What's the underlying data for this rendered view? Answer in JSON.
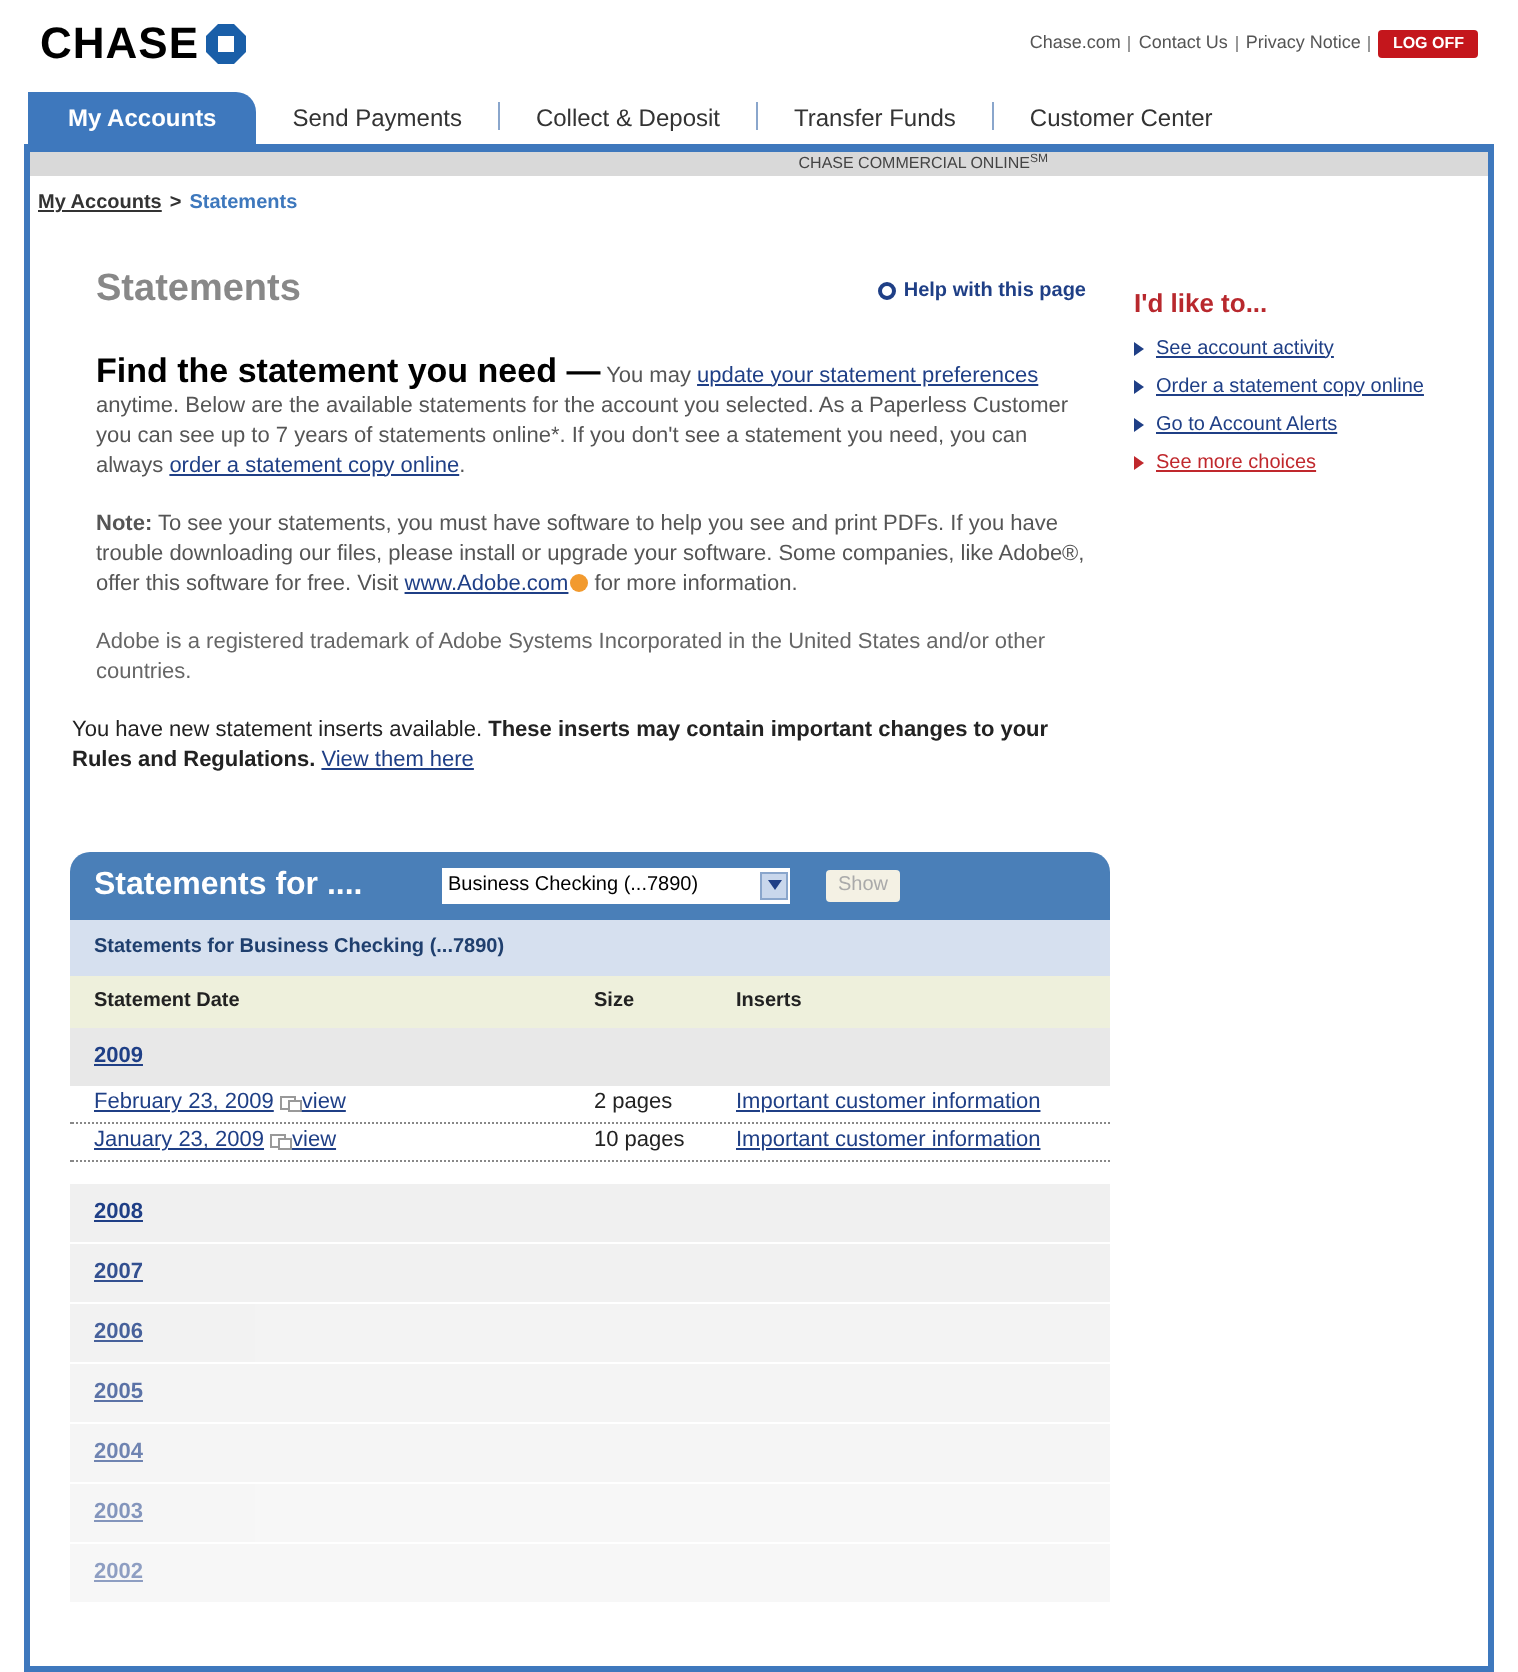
{
  "header": {
    "logo": "CHASE",
    "links": [
      "Chase.com",
      "Contact Us",
      "Privacy Notice"
    ],
    "logoff": "LOG OFF"
  },
  "tabs": [
    {
      "label": "My Accounts",
      "selected": true
    },
    {
      "label": "Send Payments",
      "selected": false
    },
    {
      "label": "Collect & Deposit",
      "selected": false
    },
    {
      "label": "Transfer Funds",
      "selected": false
    },
    {
      "label": "Customer Center",
      "selected": false
    }
  ],
  "banner": "CHASE COMMERCIAL ONLINE$^{SM}$",
  "breadcrumb": [
    {
      "label": "My Accounts",
      "kind": "link"
    },
    {
      "label": ">",
      "kind": "sep"
    },
    {
      "label": "Statements",
      "kind": "current"
    }
  ],
  "page_title": "Statements",
  "help_link": "Help with this page",
  "intro": {
    "heading": "Find the statement you need —",
    "parts": [
      {
        "kind": "text",
        "text": "You may"
      },
      {
        "kind": "link",
        "text": "update your statement preferences"
      },
      {
        "kind": "text",
        "text": "anytime. Below are the available statements for the account you selected. As a Paperless Customer you can see up to 7 years of statements online*. If you don't see a statement you need, you can always"
      },
      {
        "kind": "link",
        "text": "order a statement copy online"
      },
      {
        "kind": "text",
        "text": "."
      }
    ]
  },
  "note": [
    {
      "kind": "text",
      "text": "**Note:** To see your statements, you must have software to help you see and print PDFs. If you have trouble downloading our files, please install or upgrade your software. Some companies, like Adobe®, offer this software for free. Visit"
    },
    {
      "kind": "link",
      "text": "www.Adobe.com"
    },
    {
      "kind": "text",
      "text": "for more information."
    }
  ],
  "trademark": "Adobe is a registered trademark of Adobe Systems Incorporated in the United States and/or other countries.",
  "inserts_notice": {
    "text": "You have new statement inserts available. **These inserts may contain important changes to your Rules and Regulations.**",
    "link": "View them here"
  },
  "statements_panel": {
    "title": "Statements for ....",
    "account_select": {
      "value": "Business Checking (...7890)"
    },
    "show_button": {
      "label": "Show",
      "disabled": true
    },
    "subtitle": "Statements for Business Checking (...7890)",
    "columns": [
      "Statement Date",
      "Size",
      "Inserts"
    ],
    "years": [
      {
        "year": "2009",
        "statements": [
          {
            "date": "February 23, 2009",
            "view": "view",
            "size": "2 pages",
            "inserts": "Important customer information"
          },
          {
            "date": "January 23, 2009",
            "view": "view",
            "size": "10 pages",
            "inserts": "Important customer information"
          }
        ]
      },
      {
        "year": "2008"
      },
      {
        "year": "2007"
      },
      {
        "year": "2006"
      },
      {
        "year": "2005"
      },
      {
        "year": "2004"
      },
      {
        "year": "2003"
      },
      {
        "year": "2002"
      }
    ]
  },
  "sidebar": {
    "title": "I'd like to...",
    "links": [
      {
        "label": "See account activity",
        "kind": "normal"
      },
      {
        "label": "Order a statement copy online",
        "kind": "normal"
      },
      {
        "label": "Go to Account Alerts",
        "kind": "normal"
      },
      {
        "label": "See more choices",
        "kind": "more"
      }
    ]
  }
}
